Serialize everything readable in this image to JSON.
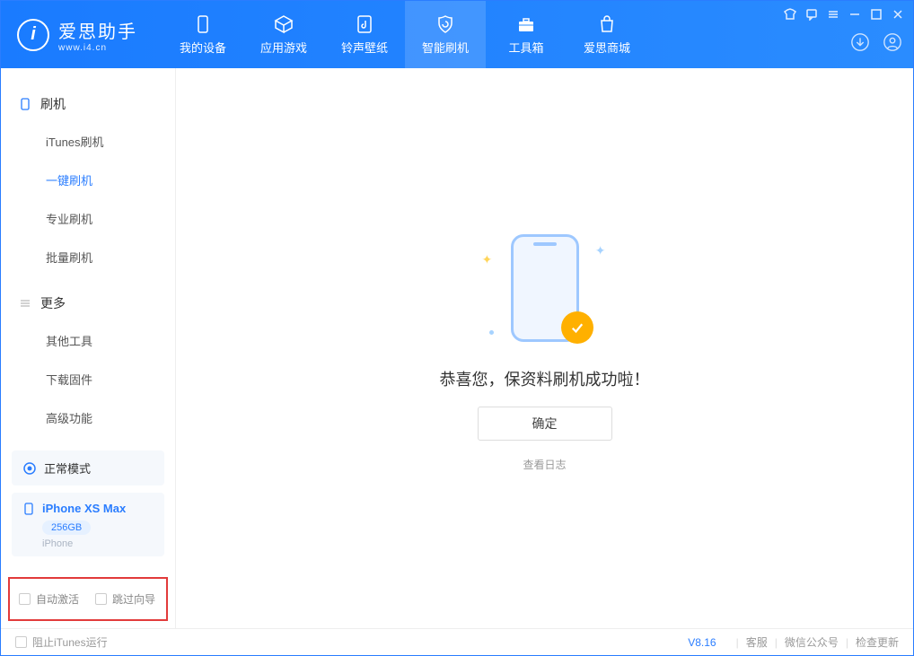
{
  "app": {
    "name": "爱思助手",
    "url": "www.i4.cn",
    "logo_letter": "i"
  },
  "nav": {
    "tabs": [
      {
        "label": "我的设备"
      },
      {
        "label": "应用游戏"
      },
      {
        "label": "铃声壁纸"
      },
      {
        "label": "智能刷机",
        "active": true
      },
      {
        "label": "工具箱"
      },
      {
        "label": "爱思商城"
      }
    ]
  },
  "sidebar": {
    "sections": [
      {
        "title": "刷机",
        "items": [
          {
            "label": "iTunes刷机"
          },
          {
            "label": "一键刷机",
            "active": true
          },
          {
            "label": "专业刷机"
          },
          {
            "label": "批量刷机"
          }
        ]
      },
      {
        "title": "更多",
        "items": [
          {
            "label": "其他工具"
          },
          {
            "label": "下载固件"
          },
          {
            "label": "高级功能"
          }
        ]
      }
    ],
    "mode": "正常模式",
    "device": {
      "name": "iPhone XS Max",
      "storage": "256GB",
      "type": "iPhone"
    },
    "options": {
      "auto_activate": "自动激活",
      "skip_guide": "跳过向导"
    }
  },
  "main": {
    "success_msg": "恭喜您，保资料刷机成功啦！",
    "confirm": "确定",
    "view_log": "查看日志"
  },
  "statusbar": {
    "block_itunes": "阻止iTunes运行",
    "version": "V8.16",
    "links": [
      "客服",
      "微信公众号",
      "检查更新"
    ]
  }
}
